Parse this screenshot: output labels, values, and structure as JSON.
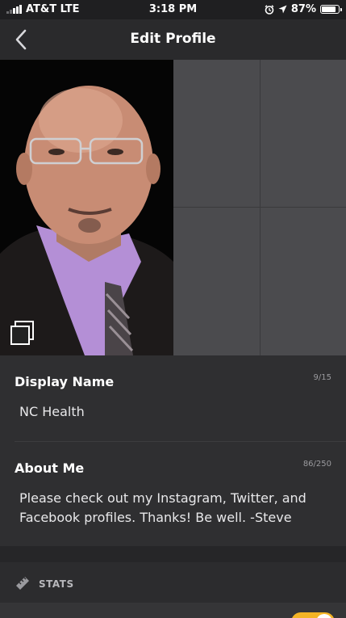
{
  "status_bar": {
    "carrier": "AT&T LTE",
    "time": "3:18 PM",
    "battery_percent": "87%",
    "battery_level": 0.87,
    "icons": [
      "signal-icon",
      "alarm-icon",
      "location-icon",
      "battery-icon"
    ]
  },
  "nav": {
    "title": "Edit Profile",
    "back_icon": "chevron-left-icon"
  },
  "photos": {
    "main_photo": "profile-photo",
    "empty_slots": 3,
    "photos_icon": "photo-stack-icon"
  },
  "display_name": {
    "label": "Display Name",
    "counter": "9/15",
    "value": "NC Health"
  },
  "about_me": {
    "label": "About Me",
    "counter": "86/250",
    "value": "Please check out my Instagram, Twitter, and Facebook profiles. Thanks! Be well. -Steve"
  },
  "stats": {
    "label": "STATS",
    "icon": "ruler-icon"
  },
  "colors": {
    "background": "#2a2a2c",
    "toggle_on": "#f4b425",
    "text_secondary": "#9a9a9e"
  }
}
